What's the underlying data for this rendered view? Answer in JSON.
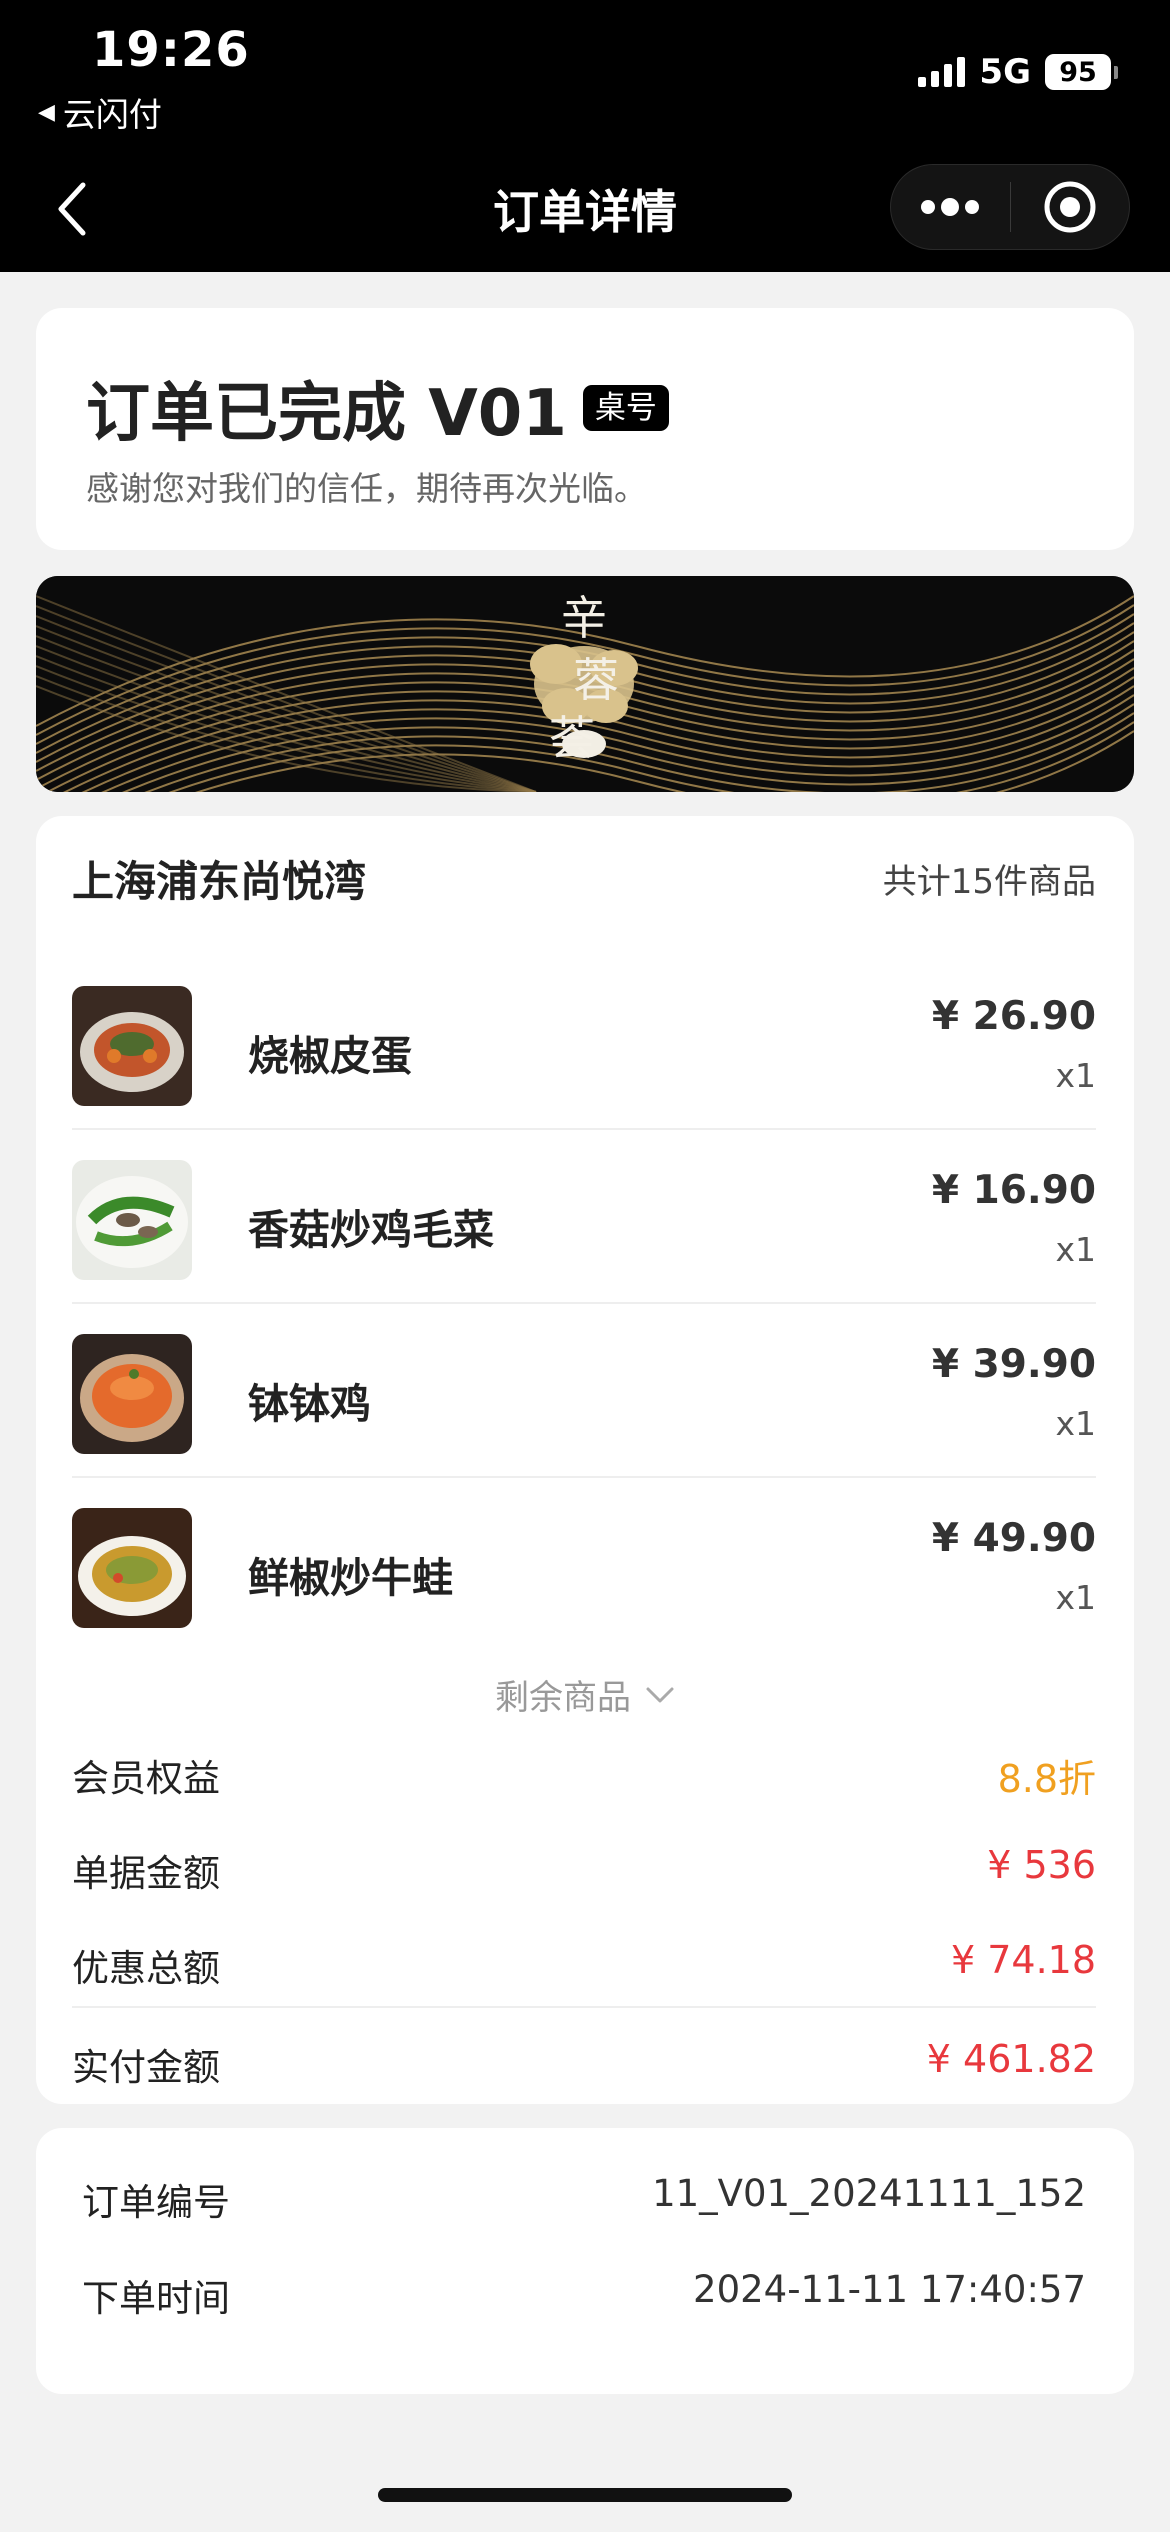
{
  "status_bar": {
    "time": "19:26",
    "back_app": "云闪付",
    "network": "5G",
    "battery": "95"
  },
  "nav": {
    "title": "订单详情",
    "more_icon": "more-dots-icon",
    "close_icon": "target-circle-icon"
  },
  "order_status": {
    "title": "订单已完成 V01",
    "table_badge": "桌号",
    "subtitle": "感谢您对我们的信任，期待再次光临。"
  },
  "banner": {
    "logo_lines": [
      "辛",
      "蓉",
      "荟"
    ]
  },
  "store": {
    "name": "上海浦东尚悦湾",
    "item_count": "共计15件商品"
  },
  "items": [
    {
      "name": "烧椒皮蛋",
      "price": "¥ 26.90",
      "qty": "x1"
    },
    {
      "name": "香菇炒鸡毛菜",
      "price": "¥ 16.90",
      "qty": "x1"
    },
    {
      "name": "钵钵鸡",
      "price": "¥ 39.90",
      "qty": "x1"
    },
    {
      "name": "鲜椒炒牛蛙",
      "price": "¥ 49.90",
      "qty": "x1"
    }
  ],
  "more_items_label": "剩余商品",
  "summary": {
    "member": {
      "label": "会员权益",
      "value": "8.8折"
    },
    "bill": {
      "label": "单据金额",
      "value": "¥ 536"
    },
    "discount": {
      "label": "优惠总额",
      "value": "¥ 74.18"
    },
    "paid": {
      "label": "实付金额",
      "value": "¥ 461.82"
    }
  },
  "order_info": {
    "number": {
      "label": "订单编号",
      "value": "11_V01_20241111_152"
    },
    "time": {
      "label": "下单时间",
      "value": "2024-11-11 17:40:57"
    }
  },
  "colors": {
    "discount_orange": "#f0a020",
    "price_red": "#e8383d",
    "gold": "#b8955a"
  }
}
